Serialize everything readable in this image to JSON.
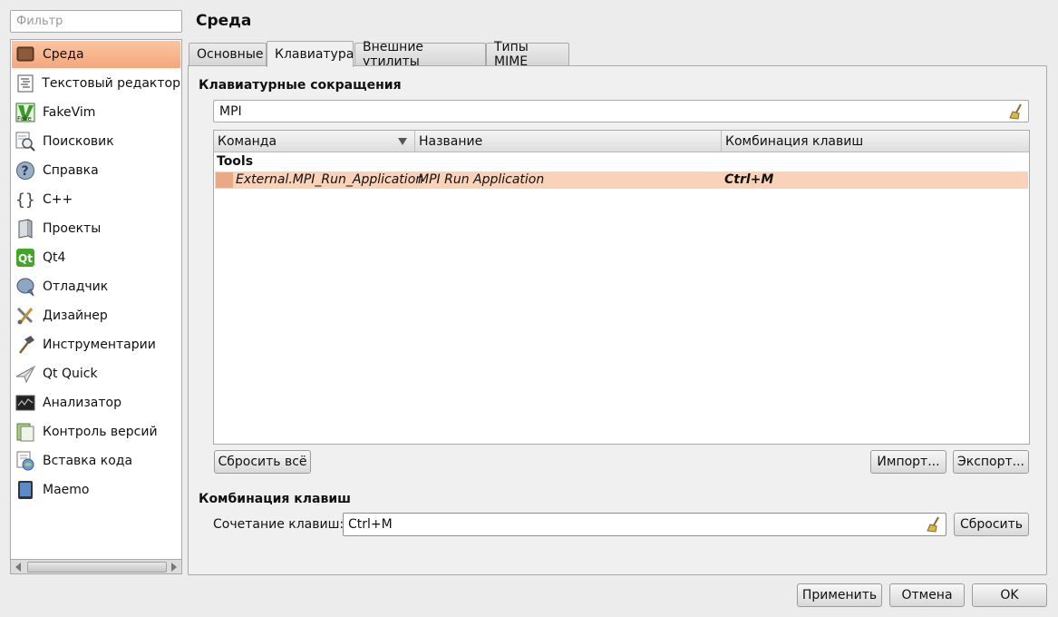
{
  "filter": {
    "placeholder": "Фильтр",
    "value": ""
  },
  "sidebar": {
    "items": [
      {
        "label": "Среда",
        "icon": "environment-icon",
        "selected": true
      },
      {
        "label": "Текстовый редактор",
        "icon": "text-editor-icon"
      },
      {
        "label": "FakeVim",
        "icon": "fakevim-icon"
      },
      {
        "label": "Поисковик",
        "icon": "locator-icon"
      },
      {
        "label": "Справка",
        "icon": "help-icon"
      },
      {
        "label": "C++",
        "icon": "cpp-braces-icon"
      },
      {
        "label": "Проекты",
        "icon": "projects-icon"
      },
      {
        "label": "Qt4",
        "icon": "qt4-icon"
      },
      {
        "label": "Отладчик",
        "icon": "debugger-icon"
      },
      {
        "label": "Дизайнер",
        "icon": "designer-icon"
      },
      {
        "label": "Инструментарии",
        "icon": "toolchains-hammer-icon"
      },
      {
        "label": "Qt Quick",
        "icon": "qt-quick-icon"
      },
      {
        "label": "Анализатор",
        "icon": "analyzer-icon"
      },
      {
        "label": "Контроль версий",
        "icon": "version-control-icon"
      },
      {
        "label": "Вставка кода",
        "icon": "code-paste-icon"
      },
      {
        "label": "Maemo",
        "icon": "maemo-device-icon"
      }
    ]
  },
  "page": {
    "title": "Среда"
  },
  "tabs": [
    {
      "label": "Основные"
    },
    {
      "label": "Клавиатура",
      "active": true
    },
    {
      "label": "Внешние утилиты"
    },
    {
      "label": "Типы MIME"
    }
  ],
  "shortcuts": {
    "title": "Клавиатурные сокращения",
    "search_value": "MPI",
    "columns": [
      "Команда",
      "Название",
      "Комбинация клавиш"
    ],
    "groups": [
      {
        "name": "Tools",
        "rows": [
          {
            "command": "External.MPI_Run_Application",
            "label": "MPI Run Application",
            "shortcut": "Ctrl+M"
          }
        ]
      }
    ],
    "reset_all_label": "Сбросить всё",
    "import_label": "Импорт...",
    "export_label": "Экспорт..."
  },
  "key_sequence": {
    "title": "Комбинация клавиш",
    "label": "Сочетание клавиш:",
    "value": "Ctrl+M",
    "reset_label": "Сбросить"
  },
  "dialog": {
    "apply_label": "Применить",
    "cancel_label": "Отмена",
    "ok_label": "OK"
  },
  "colors": {
    "selection": "#f4a77c",
    "row_highlight": "#fad2b8",
    "background": "#ececec"
  }
}
